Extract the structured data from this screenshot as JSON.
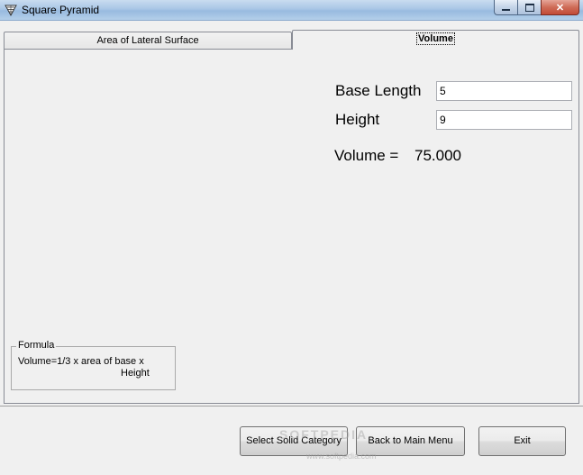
{
  "window": {
    "title": "Square Pyramid",
    "icon": "pyramid-app-icon",
    "controls": {
      "minimize": "minimize",
      "maximize": "maximize",
      "close": "✕"
    }
  },
  "tabs": [
    {
      "label": "Area of Lateral Surface",
      "selected": false
    },
    {
      "label": "Volume",
      "selected": true
    }
  ],
  "volume_panel": {
    "base_length_label": "Base Length",
    "base_length_value": "5",
    "height_label": "Height",
    "height_value": "9",
    "volume_label": "Volume =",
    "volume_value": "75.000"
  },
  "formula": {
    "caption": "Formula",
    "line1": "Volume=1/3 x area of base x",
    "line2": "Height"
  },
  "buttons": {
    "select_solid": "Select Solid Category",
    "back_main": "Back to Main Menu",
    "exit": "Exit"
  },
  "watermark": {
    "text": "SOFTPEDIA",
    "url": "www.softpedia.com"
  }
}
